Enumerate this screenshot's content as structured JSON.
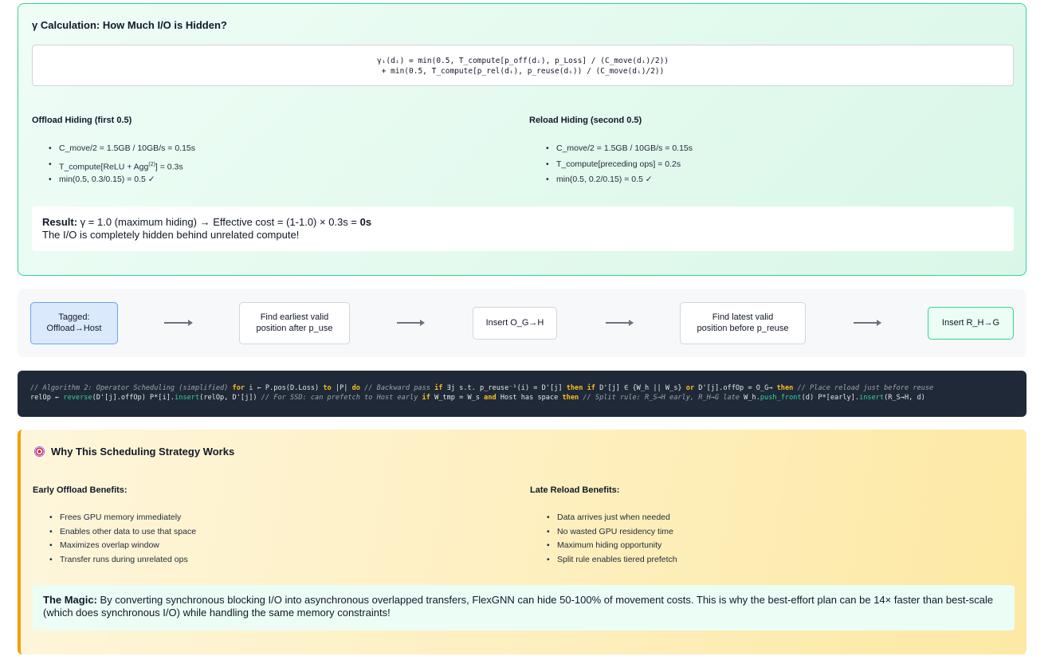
{
  "gamma": {
    "title": "γ Calculation: How Much I/O is Hidden?",
    "formula_line1": "γᵢ(dᵢ) = min(0.5, T_compute[p_off(dᵢ), p_Loss] / (C_move(dᵢ)/2))",
    "formula_line2": "+ min(0.5, T_compute[p_rel(dᵢ), p_reuse(dᵢ)) / (C_move(dᵢ)/2))",
    "offload": {
      "heading": "Offload Hiding (first 0.5)",
      "items": [
        "C_move/2 = 1.5GB / 10GB/s = 0.15s",
        "T_compute[ReLU + Agg",
        "min(0.5, 0.3/0.15) = 0.5 ✓"
      ],
      "item2_sup": "(2)",
      "item2_tail": "] = 0.3s"
    },
    "reload": {
      "heading": "Reload Hiding (second 0.5)",
      "items": [
        "C_move/2 = 1.5GB / 10GB/s = 0.15s",
        "T_compute[preceding ops] = 0.2s",
        "min(0.5, 0.2/0.15) = 0.5 ✓"
      ]
    },
    "result": {
      "label": "Result:",
      "text": " γ = 1.0 (maximum hiding) → Effective cost = (1-1.0) × 0.3s = ",
      "value": "0s",
      "line2": "The I/O is completely hidden behind unrelated compute!"
    }
  },
  "flow": {
    "nodes": [
      {
        "line1": "Tagged:",
        "line2": "Offload→Host"
      },
      {
        "line1": "Find earliest valid",
        "line2": "position after p_use"
      },
      {
        "line1": "Insert O_G→H",
        "line2": ""
      },
      {
        "line1": "Find latest valid",
        "line2": "position before p_reuse"
      },
      {
        "line1": "Insert R_H→G",
        "line2": ""
      }
    ]
  },
  "code": {
    "segments": [
      [
        "cm",
        "// Algorithm 2: Operator Scheduling (simplified) "
      ],
      [
        "kw",
        "for"
      ],
      [
        "",
        " i ← P.pos(D.Loss) "
      ],
      [
        "kw",
        "to"
      ],
      [
        "",
        " |P| "
      ],
      [
        "kw",
        "do"
      ],
      [
        "cm",
        " // Backward pass "
      ],
      [
        "kw",
        "if"
      ],
      [
        "",
        " ∃j s.t. p_reuse⁻¹(i) = D'[j] "
      ],
      [
        "kw",
        "then"
      ],
      [
        "",
        " "
      ],
      [
        "kw",
        "if"
      ],
      [
        "",
        " D'[j] ∈ {W_h || W_s} "
      ],
      [
        "kw",
        "or"
      ],
      [
        "",
        " D'[j].offOp = O_G→ "
      ],
      [
        "kw",
        "then"
      ],
      [
        "cm",
        " // Place reload just before reuse"
      ]
    ],
    "segments2": [
      [
        "",
        "relOp ← "
      ],
      [
        "fn",
        "reverse"
      ],
      [
        "",
        "(D'[j].offOp) P*[i]."
      ],
      [
        "fn",
        "insert"
      ],
      [
        "",
        "(relOp, D'[j]) "
      ],
      [
        "cm",
        "// For SSD: can prefetch to Host early "
      ],
      [
        "kw",
        "if"
      ],
      [
        "",
        " W_tmp = W_s "
      ],
      [
        "kw",
        "and"
      ],
      [
        "",
        " Host has space "
      ],
      [
        "kw",
        "then"
      ],
      [
        "cm",
        " // Split rule: R_S→H early, R_H→G late "
      ],
      [
        "",
        "W_h."
      ],
      [
        "fn",
        "push_front"
      ],
      [
        "",
        "(d) P*[early]."
      ],
      [
        "fn",
        "insert"
      ],
      [
        "",
        "(R_S→H, d)"
      ]
    ]
  },
  "why": {
    "icon": "target-icon",
    "title": "Why This Scheduling Strategy Works",
    "early": {
      "heading": "Early Offload Benefits:",
      "items": [
        "Frees GPU memory immediately",
        "Enables other data to use that space",
        "Maximizes overlap window",
        "Transfer runs during unrelated ops"
      ]
    },
    "late": {
      "heading": "Late Reload Benefits:",
      "items": [
        "Data arrives just when needed",
        "No wasted GPU residency time",
        "Maximum hiding opportunity",
        "Split rule enables tiered prefetch"
      ]
    },
    "magic": {
      "label": "The Magic:",
      "text": " By converting synchronous blocking I/O into asynchronous overlapped transfers, FlexGNN can hide 50-100% of movement costs. This is why the best-effort plan can be 14× faster than best-scale (which does synchronous I/O) while handling the same memory constraints!"
    }
  },
  "colors": {
    "gamma_border": "#34d399",
    "why_accent": "#f59e0b",
    "code_bg": "#1f2937"
  }
}
